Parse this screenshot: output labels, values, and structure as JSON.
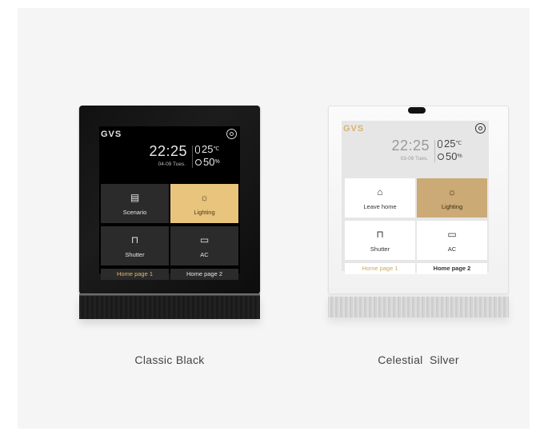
{
  "products": [
    {
      "name": "Classic Black",
      "screen": {
        "logo": "GVS",
        "time": "22:25",
        "date": "04-09 Tues.",
        "temperature": "25",
        "temperature_unit": "℃",
        "humidity": "50",
        "humidity_unit": "%",
        "tiles": [
          {
            "label": "Scenario",
            "icon": "scenario-icon",
            "active": false
          },
          {
            "label": "Lighting",
            "icon": "light-bulb-icon",
            "active": true
          },
          {
            "label": "Shutter",
            "icon": "shutter-icon",
            "active": false
          },
          {
            "label": "AC",
            "icon": "ac-icon",
            "active": false
          }
        ],
        "pages": [
          "Home page 1",
          "Home page 2"
        ]
      },
      "accent": "#e8c47c"
    },
    {
      "name": "Celestial  Silver",
      "screen": {
        "logo": "GVS",
        "time": "22:25",
        "date": "03-09 Tues.",
        "temperature": "25",
        "temperature_unit": "℃",
        "humidity": "50",
        "humidity_unit": "%",
        "tiles": [
          {
            "label": "Leave home",
            "icon": "leave-home-icon",
            "active": false
          },
          {
            "label": "Lighting",
            "icon": "light-bulb-icon",
            "active": true
          },
          {
            "label": "Shutter",
            "icon": "shutter-icon",
            "active": false
          },
          {
            "label": "AC",
            "icon": "ac-icon",
            "active": false
          }
        ],
        "pages": [
          "Home page 1",
          "Home page 2"
        ]
      },
      "accent": "#cbaa76"
    }
  ]
}
